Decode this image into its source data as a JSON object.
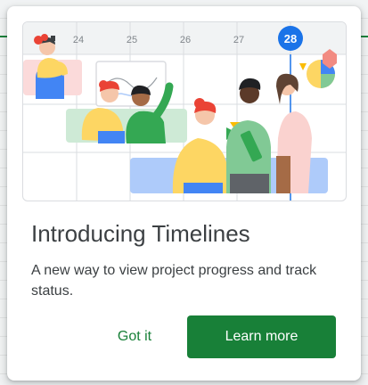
{
  "dialog": {
    "title": "Introducing Timelines",
    "description": "A new way to view project progress and track status.",
    "dismiss_label": "Got it",
    "primary_label": "Learn more"
  },
  "illustration": {
    "dates": [
      "24",
      "25",
      "26",
      "27"
    ],
    "today_date": "28"
  },
  "colors": {
    "accent_green": "#188038",
    "today_blue": "#1a73e8",
    "text_primary": "#3c4043"
  }
}
